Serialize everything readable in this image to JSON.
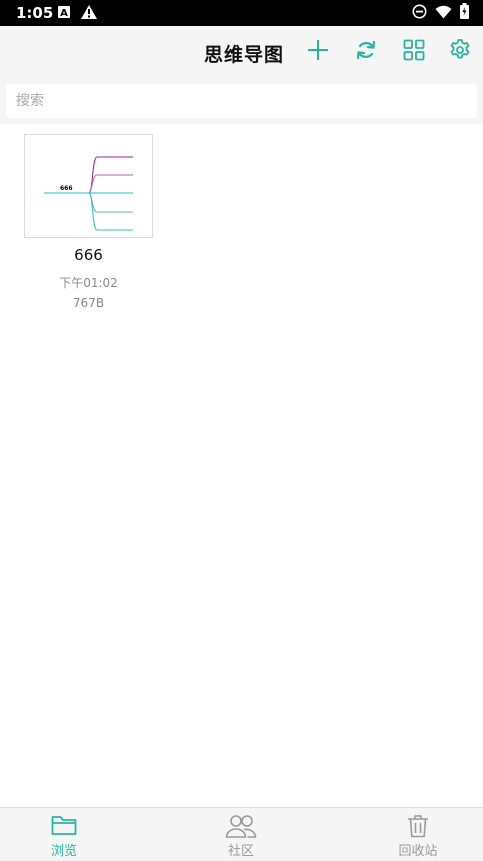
{
  "status_bar": {
    "time": "1:05",
    "icons": [
      "a-box-icon",
      "warning-icon",
      "dnd-icon",
      "wifi-icon",
      "battery-icon"
    ]
  },
  "app_bar": {
    "title": "思维导图",
    "actions": [
      "add-icon",
      "sync-icon",
      "grid-view-icon",
      "settings-icon"
    ],
    "accent_color": "#2bb5a0"
  },
  "search": {
    "placeholder": "搜索",
    "value": ""
  },
  "files": [
    {
      "name": "666",
      "time": "下午01:02",
      "size": "767B",
      "thumbnail": {
        "root_label": "666",
        "branch_colors": [
          "#a0236e",
          "#b55ed0",
          "#28b8d6",
          "#55c07f",
          "#2bc4bc"
        ]
      }
    }
  ],
  "bottom_nav": {
    "active_color": "#2bb5a0",
    "inactive_color": "#9a9a9a",
    "items": [
      {
        "label": "浏览",
        "icon": "folder-icon",
        "active": true
      },
      {
        "label": "社区",
        "icon": "people-icon",
        "active": false
      },
      {
        "label": "回收站",
        "icon": "trash-icon",
        "active": false
      }
    ]
  }
}
